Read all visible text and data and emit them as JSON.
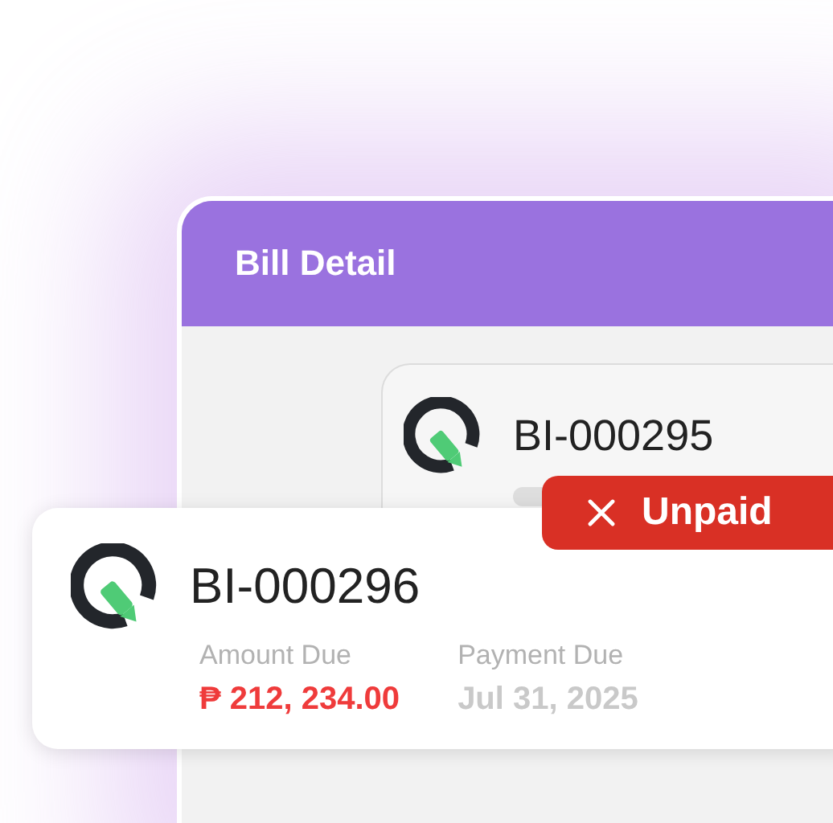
{
  "window": {
    "title": "Bill Detail"
  },
  "bills": [
    {
      "number": "BI-000295"
    },
    {
      "number": "BI-000296",
      "amount_label": "Amount Due",
      "amount": "₱ 212, 234.00",
      "due_label": "Payment Due",
      "due_date": "Jul 31, 2025"
    }
  ],
  "status_badge": {
    "label": "Unpaid"
  }
}
